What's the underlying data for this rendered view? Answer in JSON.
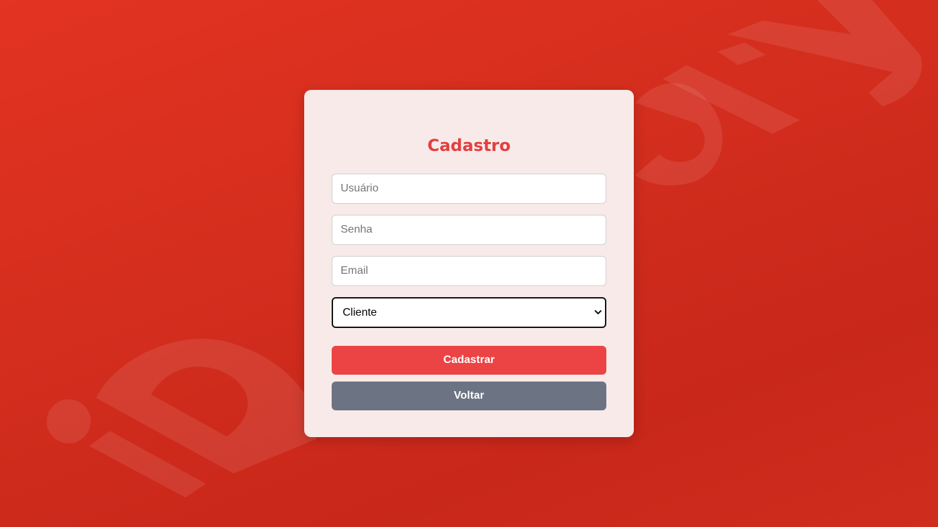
{
  "background": {
    "colors": [
      "#e33322",
      "#c8271a"
    ],
    "watermark_color": "#ffffff"
  },
  "form": {
    "title": "Cadastro",
    "title_color": "#e0403f",
    "username_placeholder": "Usuário",
    "password_placeholder": "Senha",
    "email_placeholder": "Email",
    "role_select": {
      "selected": "Cliente",
      "options": [
        "Cliente"
      ]
    },
    "submit_label": "Cadastrar",
    "submit_color": "#ec4345",
    "back_label": "Voltar",
    "back_color": "#6c7483"
  },
  "icons": {
    "select_arrow": "chevron-down-icon"
  }
}
